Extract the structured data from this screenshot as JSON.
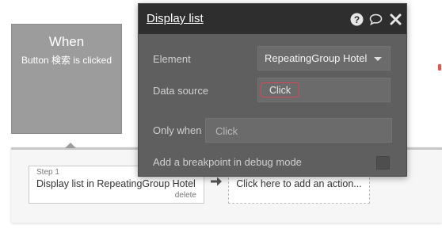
{
  "event": {
    "title": "When",
    "subtitle": "Button 検索 is clicked"
  },
  "step": {
    "label": "Step 1",
    "name": "Display list in RepeatingGroup Hotel",
    "delete_label": "delete"
  },
  "add_action": {
    "label": "Click here to add an action..."
  },
  "panel": {
    "title": "Display list",
    "element_label": "Element",
    "element_value": "RepeatingGroup Hotel",
    "data_source_label": "Data source",
    "data_source_value": "Click",
    "only_when_label": "Only when",
    "only_when_placeholder": "Click",
    "breakpoint_label": "Add a breakpoint in debug mode",
    "breakpoint_checked": false
  },
  "icons": {
    "help": "help-icon",
    "comment": "comment-icon",
    "close": "close-icon",
    "arrow": "arrow-right-icon",
    "dropdown": "chevron-down-icon"
  },
  "colors": {
    "panel_bg": "#5f5f5f",
    "header_bg": "#2e2e2e",
    "highlight": "#d9475a",
    "event_bg": "#9c9c9c"
  }
}
